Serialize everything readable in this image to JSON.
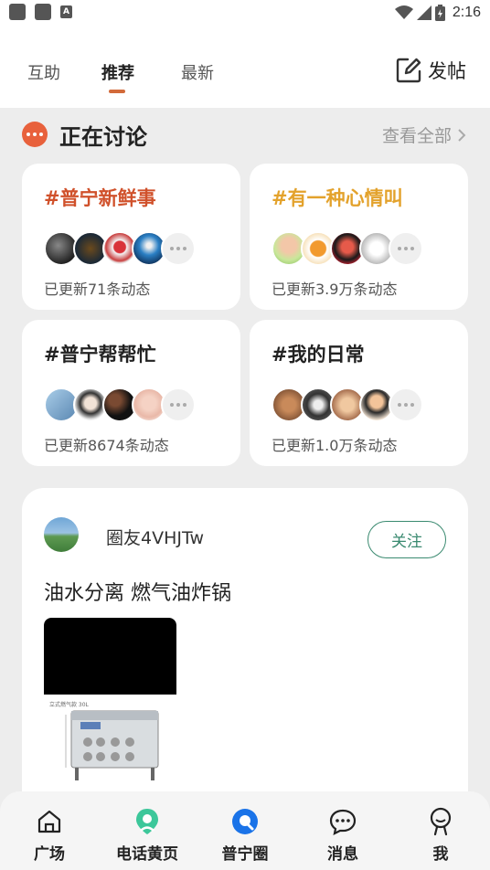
{
  "status_bar": {
    "time": "2:16"
  },
  "header": {
    "tabs": [
      {
        "label": "互助"
      },
      {
        "label": "推荐"
      },
      {
        "label": "最新"
      }
    ],
    "active_tab": "推荐",
    "post_button": "发帖"
  },
  "discussion": {
    "title": "正在讨论",
    "see_all": "查看全部",
    "topics": [
      {
        "title": "#普宁新鲜事",
        "color": "#d0512b",
        "meta": "已更新71条动态"
      },
      {
        "title": "#有一种心情叫",
        "color": "#e3a22c",
        "meta": "已更新3.9万条动态"
      },
      {
        "title": "#普宁帮帮忙",
        "color": "#222222",
        "meta": "已更新8674条动态"
      },
      {
        "title": "#我的日常",
        "color": "#222222",
        "meta": "已更新1.0万条动态"
      }
    ]
  },
  "post": {
    "username": "圈友4VHJTw",
    "follow_label": "关注",
    "text": "油水分离 燃气油炸锅",
    "image_caption": "立式燃气款 30L"
  },
  "bottom_nav": {
    "items": [
      {
        "label": "广场",
        "icon": "home-icon"
      },
      {
        "label": "电话黄页",
        "icon": "yellow-pages-icon"
      },
      {
        "label": "普宁圈",
        "icon": "circle-icon"
      },
      {
        "label": "消息",
        "icon": "message-icon"
      },
      {
        "label": "我",
        "icon": "profile-icon"
      }
    ],
    "active": "普宁圈",
    "colors": {
      "accent_green": "#3cc79a",
      "accent_blue": "#1a73e8"
    }
  }
}
